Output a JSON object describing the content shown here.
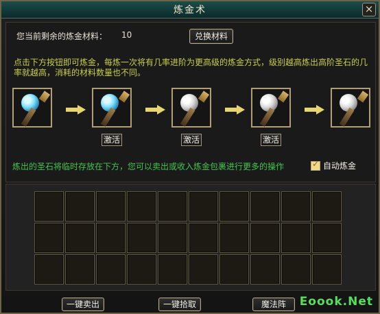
{
  "window": {
    "title": "炼金术",
    "close_icon": "close-icon"
  },
  "material": {
    "label": "您当前剩余的炼金材料：",
    "count": "10",
    "exchange_button": "兑换材料"
  },
  "description": "点击下方按钮即可炼金，每炼一次将有几率进阶为更高级的炼金方式，级别越高炼出高阶圣石的几率就越高，消耗的材料数量也不同。",
  "alchemy_chain": [
    {
      "state": "active",
      "activate_label": ""
    },
    {
      "state": "active",
      "activate_label": "激活"
    },
    {
      "state": "inactive",
      "activate_label": "激活"
    },
    {
      "state": "inactive",
      "activate_label": "激活"
    },
    {
      "state": "inactive",
      "activate_label": ""
    }
  ],
  "hint": "炼出的圣石将临时存放在下方，您可以卖出或收入炼金包裹进行更多的操作",
  "auto_alchemy": {
    "label": "自动炼金",
    "checked": true
  },
  "grid": {
    "rows": 3,
    "columns": 10
  },
  "buttons": {
    "sell_all": "一键卖出",
    "pick_all": "一键拾取",
    "magic_array": "魔法阵"
  },
  "watermark": "Eoook.Net"
}
